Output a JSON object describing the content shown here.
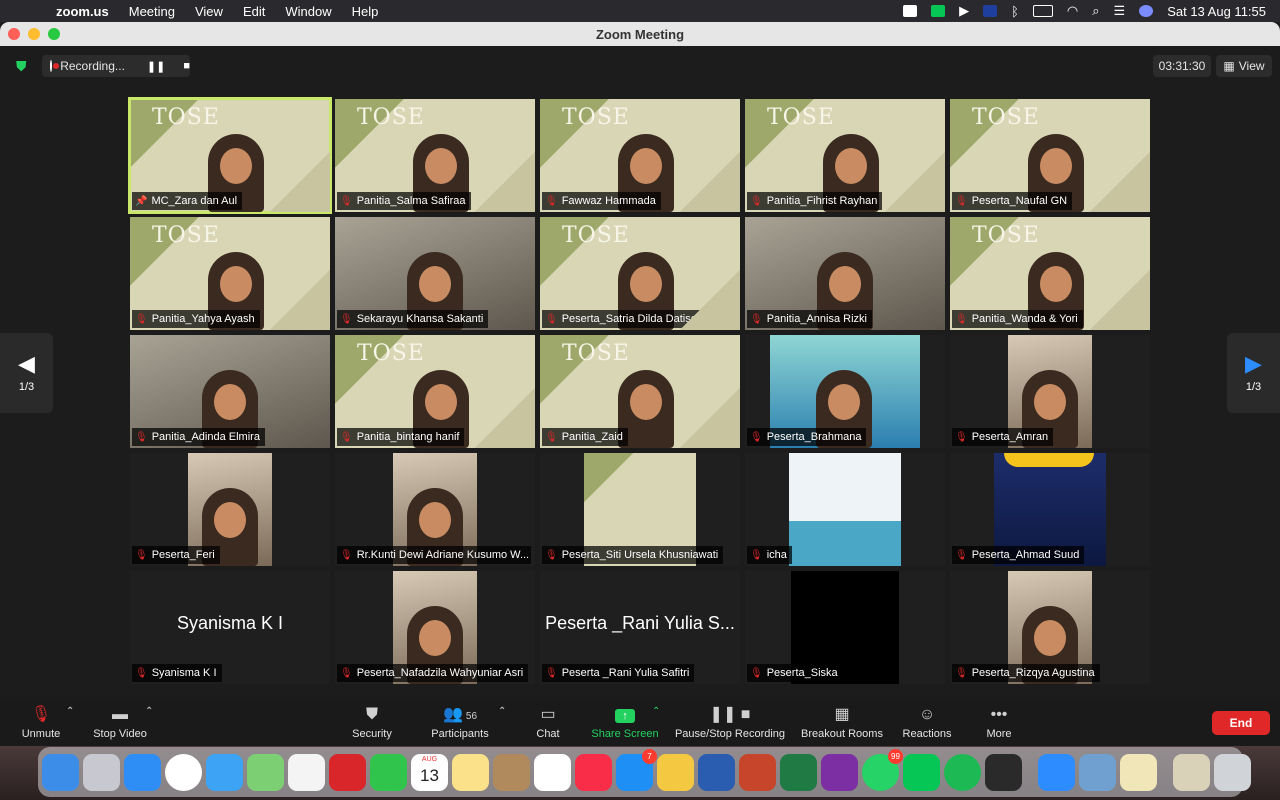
{
  "menubar": {
    "app": "zoom.us",
    "items": [
      "Meeting",
      "View",
      "Edit",
      "Window",
      "Help"
    ],
    "clock": "Sat 13 Aug  11:55"
  },
  "window": {
    "title": "Zoom Meeting"
  },
  "topstrip": {
    "recording_label": "Recording...",
    "timer": "03:31:30",
    "view_label": "View"
  },
  "pagination": {
    "left": "1/3",
    "right": "1/3"
  },
  "tiles": [
    {
      "name": "MC_Zara dan Aul",
      "type": "slide",
      "muted": false,
      "pinned": true,
      "active": true
    },
    {
      "name": "Panitia_Salma Safiraa",
      "type": "slide",
      "muted": true
    },
    {
      "name": "Fawwaz Hammada",
      "type": "slide",
      "muted": true
    },
    {
      "name": "Panitia_Fihrist Rayhan",
      "type": "slide",
      "muted": true
    },
    {
      "name": "Peserta_Naufal GN",
      "type": "slide",
      "muted": true
    },
    {
      "name": "Panitia_Yahya Ayash",
      "type": "slide",
      "muted": true
    },
    {
      "name": "Sekarayu Khansa Sakanti",
      "type": "photo",
      "muted": true
    },
    {
      "name": "Peserta_Satria Dilda Datischa",
      "type": "slide",
      "muted": true
    },
    {
      "name": "Panitia_Annisa Rizki",
      "type": "photo",
      "muted": true
    },
    {
      "name": "Panitia_Wanda & Yori",
      "type": "slide",
      "muted": true
    },
    {
      "name": "Panitia_Adinda Elmira",
      "type": "photo",
      "muted": true
    },
    {
      "name": "Panitia_bintang hanif",
      "type": "slide",
      "muted": true
    },
    {
      "name": "Panitia_Zaid",
      "type": "slide",
      "muted": true
    },
    {
      "name": "Peserta_Brahmana",
      "type": "teal",
      "muted": true
    },
    {
      "name": "Peserta_Amran",
      "type": "portrait",
      "muted": true
    },
    {
      "name": "Peserta_Feri",
      "type": "portrait",
      "muted": true
    },
    {
      "name": "Rr.Kunti Dewi Adriane Kusumo W...",
      "type": "portrait",
      "muted": true
    },
    {
      "name": "Peserta_Siti Ursela Khusniawati",
      "type": "wide",
      "muted": true
    },
    {
      "name": "icha",
      "type": "cartoon",
      "muted": true
    },
    {
      "name": "Peserta_Ahmad Suud",
      "type": "blue",
      "muted": true
    },
    {
      "name": "Syanisma K I",
      "type": "text",
      "display": "Syanisma K I",
      "muted": true
    },
    {
      "name": "Peserta_Nafadzila Wahyuniar Asri",
      "type": "portrait",
      "muted": true
    },
    {
      "name": "Peserta _Rani Yulia Safitri",
      "type": "text",
      "display": "Peserta _Rani Yulia S...",
      "muted": true
    },
    {
      "name": "Peserta_Siska",
      "type": "black",
      "muted": true
    },
    {
      "name": "Peserta_Rizqya Agustina",
      "type": "portrait",
      "muted": true
    }
  ],
  "toolbar": {
    "unmute": "Unmute",
    "stop_video": "Stop Video",
    "security": "Security",
    "participants": "Participants",
    "participants_count": "56",
    "chat": "Chat",
    "share_screen": "Share Screen",
    "pause_stop": "Pause/Stop Recording",
    "breakout": "Breakout Rooms",
    "reactions": "Reactions",
    "more": "More",
    "end": "End"
  },
  "dock": {
    "calendar_month": "AUG",
    "calendar_day": "13",
    "appstore_badge": "7",
    "whatsapp_badge": "99"
  },
  "colors": {
    "share_green": "#23d160",
    "end_red": "#e02828",
    "active_speaker": "#c9e86a",
    "next_arrow": "#2d8cff"
  }
}
